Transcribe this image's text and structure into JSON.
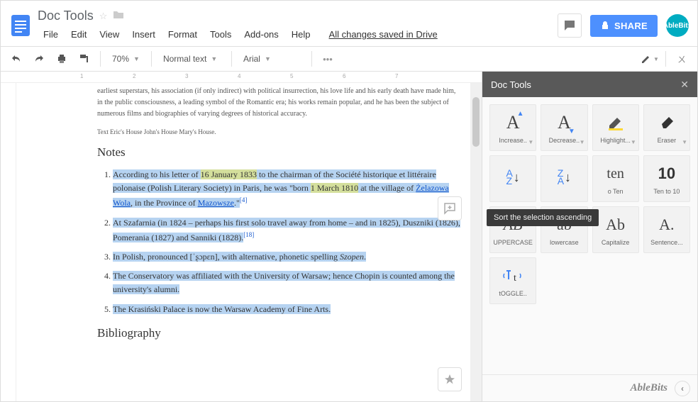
{
  "header": {
    "doc_title": "Doc Tools",
    "menus": [
      "File",
      "Edit",
      "View",
      "Insert",
      "Format",
      "Tools",
      "Add-ons",
      "Help"
    ],
    "save_status": "All changes saved in Drive",
    "share_label": "SHARE",
    "avatar": "AbleBits"
  },
  "toolbar": {
    "zoom": "70%",
    "style": "Normal text",
    "font": "Arial"
  },
  "doc": {
    "intro": "earliest superstars, his association (if only indirect) with political insurrection, his love life and his early death have made him, in the public consciousness, a leading symbol of the Romantic era; his works remain popular, and he has been the subject of numerous films and biographies of varying degrees of historical accuracy.",
    "line_small": "Text Eric's House John's House Mary's House.",
    "notes_heading": "Notes",
    "notes": [
      {
        "pre": "According to his letter of ",
        "hl1": "16 January 1833",
        "mid1": " to the chairman of the Société historique et littéraire polonaise (Polish Literary Society) in Paris, he was \"born ",
        "hl2": "1 March 1810",
        "mid2": " at the village of ",
        "link1": "Żelazowa Wola",
        "mid3": ", in the Province of ",
        "link2": "Mazowsze",
        "tail": ".\"",
        "ref": "[4]"
      },
      {
        "text": "At Szafarnia (in 1824 – perhaps his first solo travel away from home – and in 1825), Duszniki (1826), Pomerania (1827) and Sanniki (1828).",
        "ref": "[18]"
      },
      {
        "pre": "In Polish, pronounced [ˈʂɔpɛn], with alternative, phonetic spelling ",
        "ital": "Szopen",
        "tail": "."
      },
      {
        "text": "The Conservatory was affiliated with the University of Warsaw; hence Chopin is counted among the university's alumni."
      },
      {
        "text": "The Krasiński Palace is now the Warsaw Academy of Fine Arts."
      }
    ],
    "bibliography_heading": "Bibliography"
  },
  "sidebar": {
    "title": "Doc Tools",
    "tooltip": "Sort the selection ascending",
    "buttons": [
      {
        "id": "increase-font",
        "label": "Increase..",
        "drop": true
      },
      {
        "id": "decrease-font",
        "label": "Decrease..",
        "drop": true
      },
      {
        "id": "highlight",
        "label": "Highlight...",
        "drop": true
      },
      {
        "id": "eraser",
        "label": "Eraser",
        "drop": true
      },
      {
        "id": "sort-asc",
        "label": ""
      },
      {
        "id": "sort-desc",
        "label": ""
      },
      {
        "id": "num-to-text",
        "label": "o Ten"
      },
      {
        "id": "text-to-num",
        "label": "Ten to 10"
      },
      {
        "id": "uppercase",
        "label": "UPPERCASE"
      },
      {
        "id": "lowercase",
        "label": "lowercase"
      },
      {
        "id": "capitalize",
        "label": "Capitalize"
      },
      {
        "id": "sentence",
        "label": "Sentence..."
      },
      {
        "id": "toggle",
        "label": "tOGGLE.."
      }
    ],
    "footer": "AbleBits"
  }
}
